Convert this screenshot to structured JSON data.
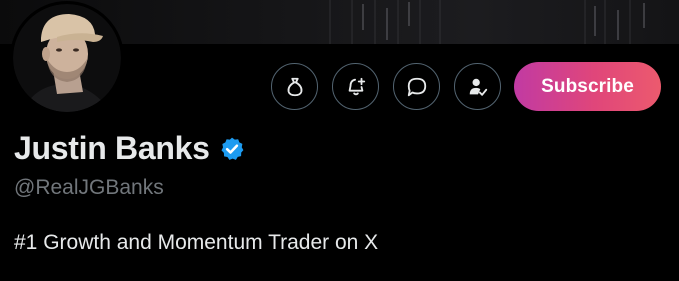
{
  "profile": {
    "display_name": "Justin Banks",
    "handle": "@RealJGBanks",
    "bio": "#1 Growth and Momentum Trader on X",
    "verified": true
  },
  "actions": {
    "buttons": [
      {
        "icon": "money-bag-icon"
      },
      {
        "icon": "bell-plus-icon"
      },
      {
        "icon": "message-icon"
      },
      {
        "icon": "user-check-icon"
      }
    ],
    "subscribe_label": "Subscribe"
  },
  "colors": {
    "background": "#000000",
    "text_primary": "#e7e9ea",
    "text_secondary": "#71767b",
    "verified_badge": "#1d9bf0",
    "subscribe_start": "#c13aa3",
    "subscribe_end": "#ec5a6e",
    "button_border": "#536471"
  }
}
